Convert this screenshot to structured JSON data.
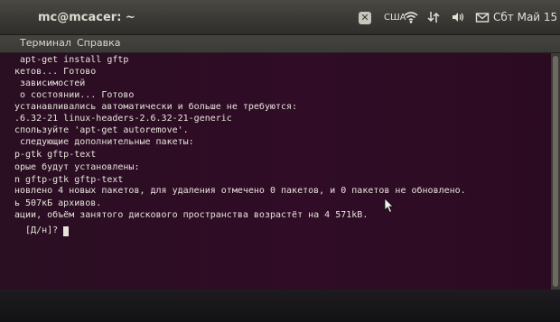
{
  "window": {
    "title": "mc@mcacer: ~"
  },
  "panel": {
    "keyboard_layout": "США",
    "clock": "Сбт Май 15",
    "icons": [
      "wifi-icon",
      "network-icon",
      "volume-icon",
      "mail-icon"
    ]
  },
  "menu": {
    "items": [
      "Терминал",
      "Справка"
    ]
  },
  "terminal": {
    "lines": [
      " apt-get install gftp",
      "кетов... Готово",
      " зависимостей",
      " о состоянии... Готово",
      "устанавливались автоматически и больше не требуются:",
      ".6.32-21 linux-headers-2.6.32-21-generic",
      "спользуйте 'apt-get autoremove'.",
      " следующие дополнительные пакеты:",
      "p-gtk gftp-text",
      "орые будут установлены:",
      "n gftp-gtk gftp-text",
      "новлено 4 новых пакетов, для удаления отмечено 0 пакетов, и 0 пакетов не обновлено.",
      "ь 507кБ архивов.",
      "ации, объём занятого дискового пространства возрастёт на 4 571kB.",
      "  [Д/н]? "
    ]
  },
  "colors": {
    "terminal_bg": "#300a24",
    "terminal_fg": "#e8e4dc",
    "panel_bg": "#3c3b37"
  }
}
